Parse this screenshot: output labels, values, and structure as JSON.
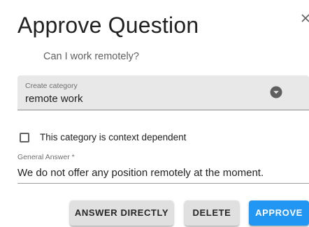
{
  "dialog": {
    "title": "Approve Question",
    "close_icon": "close-icon",
    "question": "Can I work remotely?"
  },
  "category": {
    "label": "Create category",
    "value": "remote work",
    "icon": "dropdown-arrow-icon"
  },
  "context_checkbox": {
    "label": "This category is context dependent",
    "checked": false
  },
  "answer": {
    "label": "General Answer *",
    "value": "We do not offer any position remotely at the moment."
  },
  "actions": {
    "answer_directly": "ANSWER DIRECTLY",
    "delete": "DELETE",
    "approve": "APPROVE"
  },
  "colors": {
    "primary": "#2196f3",
    "secondary_button": "#e0e0e0",
    "select_background": "#e8e8e8"
  }
}
